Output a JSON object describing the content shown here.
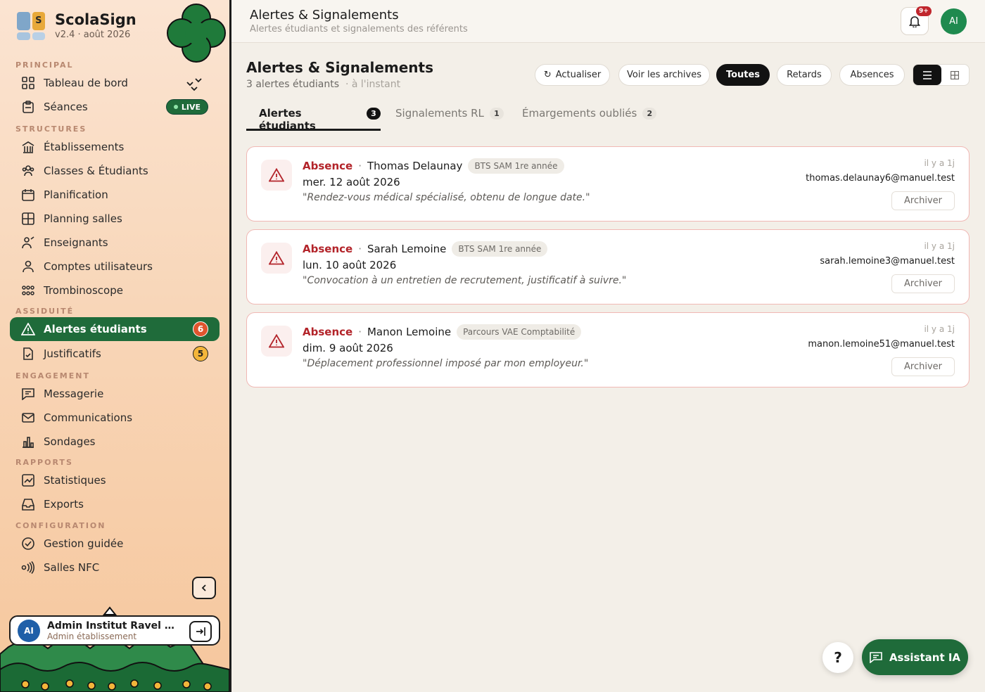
{
  "brand": {
    "name": "ScolaSign",
    "version": "v2.4 · août 2026",
    "logo_letter": "S"
  },
  "sidebar": {
    "sections": {
      "principal": "PRINCIPAL",
      "structures": "STRUCTURES",
      "assiduite": "ASSIDUITÉ",
      "engagement": "ENGAGEMENT",
      "rapports": "RAPPORTS",
      "configuration": "CONFIGURATION"
    },
    "items": {
      "dashboard": "Tableau de bord",
      "seances": "Séances",
      "etablissements": "Établissements",
      "classes": "Classes & Étudiants",
      "planification": "Planification",
      "planning_salles": "Planning salles",
      "enseignants": "Enseignants",
      "comptes": "Comptes utilisateurs",
      "trombinoscope": "Trombinoscope",
      "alertes": "Alertes étudiants",
      "justificatifs": "Justificatifs",
      "messagerie": "Messagerie",
      "communications": "Communications",
      "sondages": "Sondages",
      "statistiques": "Statistiques",
      "exports": "Exports",
      "gestion_guidee": "Gestion guidée",
      "salles_nfc": "Salles NFC"
    },
    "live_label": "LIVE",
    "alertes_count": "6",
    "justificatifs_count": "5",
    "accent_color": "#1f6b3a"
  },
  "user": {
    "initials": "AI",
    "name": "Admin Institut Ravel For...",
    "role": "Admin établissement"
  },
  "topbar": {
    "title": "Alertes & Signalements",
    "subtitle": "Alertes étudiants et signalements des référents",
    "notif_badge": "9+",
    "avatar_initials": "AI"
  },
  "page": {
    "title": "Alertes & Signalements",
    "count_text": "3 alertes étudiants",
    "updated_text": "· à l'instant"
  },
  "toolbar": {
    "refresh": "Actualiser",
    "archives": "Voir les archives",
    "filters": [
      "Toutes",
      "Retards",
      "Absences"
    ],
    "active_filter": "Toutes"
  },
  "tabs": [
    {
      "label": "Alertes étudiants",
      "count": "3"
    },
    {
      "label": "Signalements RL",
      "count": "1"
    },
    {
      "label": "Émargements oubliés",
      "count": "2"
    }
  ],
  "alerts": [
    {
      "type": "Absence",
      "name": "Thomas Delaunay",
      "tag": "BTS SAM 1re année",
      "date": "mer. 12 août 2026",
      "quote": "\"Rendez-vous médical spécialisé, obtenu de longue date.\"",
      "time": "il y a 1j",
      "email": "thomas.delaunay6@manuel.test",
      "action": "Archiver"
    },
    {
      "type": "Absence",
      "name": "Sarah Lemoine",
      "tag": "BTS SAM 1re année",
      "date": "lun. 10 août 2026",
      "quote": "\"Convocation à un entretien de recrutement, justificatif à suivre.\"",
      "time": "il y a 1j",
      "email": "sarah.lemoine3@manuel.test",
      "action": "Archiver"
    },
    {
      "type": "Absence",
      "name": "Manon Lemoine",
      "tag": "Parcours VAE Comptabilité",
      "date": "dim. 9 août 2026",
      "quote": "\"Déplacement professionnel imposé par mon employeur.\"",
      "time": "il y a 1j",
      "email": "manon.lemoine51@manuel.test",
      "action": "Archiver"
    }
  ],
  "floating": {
    "help": "?",
    "assistant": "Assistant IA"
  }
}
